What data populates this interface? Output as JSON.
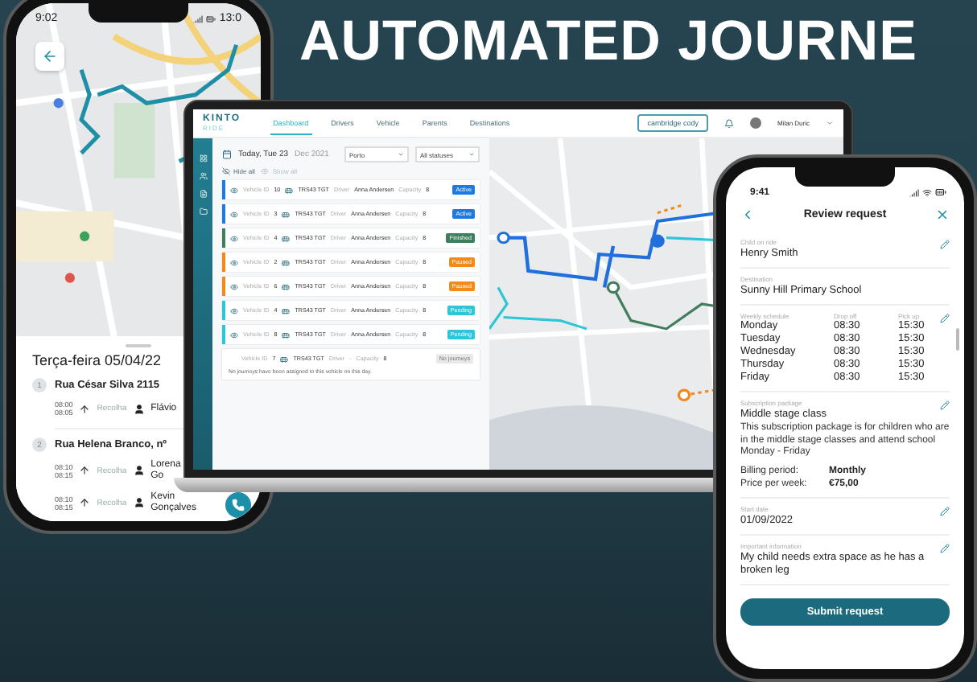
{
  "headline": "AUTOMATED JOURNE",
  "driver_phone": {
    "status_time": "9:02",
    "status_time_right": "13:0",
    "day_title": "Terça-feira 05/04/22",
    "stops": [
      {
        "number": "1",
        "address": "Rua César Silva 2115",
        "pickups": [
          {
            "times": [
              "08:00",
              "08:05"
            ],
            "action": "Recolha",
            "passenger": [
              "Flávio"
            ]
          }
        ]
      },
      {
        "number": "2",
        "address": "Rua Helena Branco, nº",
        "pickups": [
          {
            "times": [
              "08:10",
              "08:15"
            ],
            "action": "Recolha",
            "passenger": [
              "Lorena",
              "Go"
            ]
          },
          {
            "times": [
              "08:10",
              "08:15"
            ],
            "action": "Recolha",
            "passenger": [
              "Kevin",
              "Gonçalves"
            ]
          }
        ]
      }
    ]
  },
  "dashboard": {
    "logo": "KINTO",
    "logo_sub": "RIDE",
    "tabs": [
      {
        "label": "Dashboard",
        "selected": true
      },
      {
        "label": "Drivers",
        "selected": false
      },
      {
        "label": "Vehicle",
        "selected": false
      },
      {
        "label": "Parents",
        "selected": false
      },
      {
        "label": "Destinations",
        "selected": false
      }
    ],
    "company_button": "cambridge cody",
    "user_name": "Milan Duric",
    "date_main": "Today, Tue 23",
    "date_rest": "Dec 2021",
    "city_select": "Porto",
    "status_select": "All statuses",
    "hide_all": "Hide all",
    "show_all": "Show all",
    "vehicles": [
      {
        "vehicle_label": "Vehicle ID",
        "vehicle_id": "10",
        "plate": "TRS43 TGT",
        "driver_label": "Driver",
        "driver": "Anna Andersen",
        "capacity_label": "Capacity",
        "capacity": "8",
        "status": "Active",
        "color": "#1f7ae0"
      },
      {
        "vehicle_label": "Vehicle ID",
        "vehicle_id": "3",
        "plate": "TRS43 TGT",
        "driver_label": "Driver",
        "driver": "Anna Andersen",
        "capacity_label": "Capacity",
        "capacity": "8",
        "status": "Active",
        "color": "#1f7ae0"
      },
      {
        "vehicle_label": "Vehicle ID",
        "vehicle_id": "4",
        "plate": "TRS43 TGT",
        "driver_label": "Driver",
        "driver": "Anna Andersen",
        "capacity_label": "Capacity",
        "capacity": "8",
        "status": "Finished",
        "color": "#3f7d5c"
      },
      {
        "vehicle_label": "Vehicle ID",
        "vehicle_id": "2",
        "plate": "TRS43 TGT",
        "driver_label": "Driver",
        "driver": "Anna Andersen",
        "capacity_label": "Capacity",
        "capacity": "8",
        "status": "Paused",
        "color": "#f28a1a"
      },
      {
        "vehicle_label": "Vehicle ID",
        "vehicle_id": "6",
        "plate": "TRS43 TGT",
        "driver_label": "Driver",
        "driver": "Anna Andersen",
        "capacity_label": "Capacity",
        "capacity": "8",
        "status": "Paused",
        "color": "#f28a1a"
      },
      {
        "vehicle_label": "Vehicle ID",
        "vehicle_id": "4",
        "plate": "TRS43 TGT",
        "driver_label": "Driver",
        "driver": "Anna Andersen",
        "capacity_label": "Capacity",
        "capacity": "8",
        "status": "Pending",
        "color": "#2cc6d6"
      },
      {
        "vehicle_label": "Vehicle ID",
        "vehicle_id": "8",
        "plate": "TRS43 TGT",
        "driver_label": "Driver",
        "driver": "Anna Andersen",
        "capacity_label": "Capacity",
        "capacity": "8",
        "status": "Pending",
        "color": "#2cc6d6"
      }
    ],
    "empty_vehicle": {
      "vehicle_label": "Vehicle ID",
      "vehicle_id": "7",
      "plate": "TRS43 TGT",
      "driver_label": "Driver",
      "driver": "-",
      "capacity_label": "Capacity",
      "capacity": "8",
      "status": "No journeys",
      "message": "No journeys have been assigned to this vehicle on this day."
    }
  },
  "review_phone": {
    "time": "9:41",
    "title": "Review request",
    "sections": [
      {
        "kind": "text",
        "label": "Child on ride",
        "value": "Henry Smith",
        "editable": true
      },
      {
        "kind": "text",
        "label": "Destination",
        "value": "Sunny Hill Primary School",
        "editable": false
      },
      {
        "kind": "schedule",
        "label": "Weekly schedule",
        "columns": [
          "Drop off",
          "Pick up"
        ],
        "editable": true,
        "days": [
          {
            "day": "Monday",
            "drop_off": "08:30",
            "pick_up": "15:30"
          },
          {
            "day": "Tuesday",
            "drop_off": "08:30",
            "pick_up": "15:30"
          },
          {
            "day": "Wednesday",
            "drop_off": "08:30",
            "pick_up": "15:30"
          },
          {
            "day": "Thursday",
            "drop_off": "08:30",
            "pick_up": "15:30"
          },
          {
            "day": "Friday",
            "drop_off": "08:30",
            "pick_up": "15:30"
          }
        ]
      },
      {
        "kind": "package",
        "label": "Subscription package",
        "value": "Middle stage class",
        "editable": true,
        "description": "This subscription package is for children who are in the middle stage classes and attend school Monday - Friday",
        "details": [
          {
            "name": "Billing period:",
            "value": "Monthly"
          },
          {
            "name": "Price per week:",
            "value": "€75,00"
          }
        ]
      },
      {
        "kind": "text",
        "label": "Start date",
        "value": "01/09/2022",
        "editable": true
      },
      {
        "kind": "text",
        "label": "Important information",
        "value": "My child needs extra space as he has a broken leg",
        "editable": true
      }
    ],
    "submit": "Submit request"
  }
}
